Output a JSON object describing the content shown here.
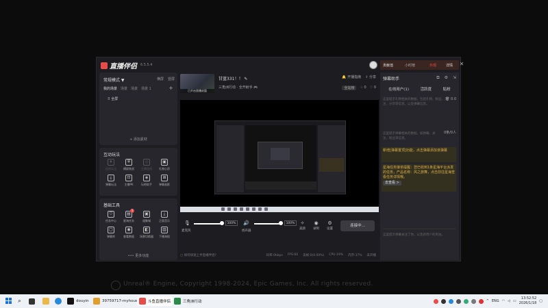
{
  "app": {
    "logo_text": "直播伴侣",
    "version": "6.5.5.4",
    "accent": "#e94a4a"
  },
  "left": {
    "mode_label": "常规模式 ▼",
    "mode_links": [
      "横屏",
      "竖屏"
    ],
    "scene_tabs": [
      "我的场景",
      "场景",
      "场景",
      "场景 1"
    ],
    "scene_item": "全屏",
    "add_source": "+ 添加素材",
    "interact_title": "互动玩法",
    "interact_tools": [
      {
        "label": "连线玩法",
        "icon": "♦",
        "dim": true
      },
      {
        "label": "横屏挑战",
        "icon": "⛨",
        "dim": false
      },
      {
        "label": "主播连线",
        "icon": "◎",
        "dim": true
      },
      {
        "label": "礼物心愿",
        "icon": "▣",
        "dim": false
      },
      {
        "label": "弹幕玩法",
        "icon": "⤓",
        "dim": false
      },
      {
        "label": "主播PK",
        "icon": "⊡",
        "dim": false
      },
      {
        "label": "玩吧助手",
        "icon": "◈",
        "dim": false
      },
      {
        "label": "弹幕画影",
        "icon": "⊞",
        "dim": false
      }
    ],
    "basic_title": "基础工具",
    "basic_tools": [
      {
        "label": "任务中心",
        "icon": "⛉",
        "badge": ""
      },
      {
        "label": "星海任务",
        "icon": "▤",
        "badge": "1"
      },
      {
        "label": "道聚城",
        "icon": "▣",
        "badge": ""
      },
      {
        "label": "正版音乐",
        "icon": "⤓",
        "badge": ""
      },
      {
        "label": "弹幕库",
        "icon": "▢",
        "badge": ""
      },
      {
        "label": "查看数据",
        "icon": "◉",
        "badge": ""
      },
      {
        "label": "场景切换器",
        "icon": "◧",
        "badge": ""
      },
      {
        "label": "下播海报",
        "icon": "▥",
        "badge": ""
      }
    ],
    "more": "••• 更多功能"
  },
  "center": {
    "cover_label": "已开启直播封面",
    "stream_title": "甘蓝331！！",
    "stream_sub": "三角洲行动 · 全开射手 🎮",
    "top_links": [
      "开播指南",
      "分享"
    ],
    "stats": [
      "全站榜",
      "0",
      "0"
    ],
    "mic_label": "麦克风",
    "mic_pct": "100%",
    "speaker_label": "扬声器",
    "speaker_pct": "100%",
    "btn_beauty": "美颜",
    "btn_record": "录制",
    "btn_settings": "设置",
    "connect": "连接中...",
    "status_left": "如何快速上手直播伴侣?",
    "status_right": [
      "码率:0kbps",
      "FPS:60",
      "丢帧:0(0.00%)",
      "CPU:19%",
      "内存:37%",
      "未开播"
    ]
  },
  "right": {
    "top_tabs": [
      "贡献值",
      "小时榜",
      "外观",
      "详情"
    ],
    "helper_title": "弹幕助手",
    "tabs": [
      "在线用户(1)",
      "活跃度",
      "贴粉"
    ],
    "txt1": "这里提示礼物相关的数据，包括礼物、粉丝、关注、分享等信息，以及弹幕信息。",
    "count1": "0.0",
    "txt2": "这里提示弹幕相关的数据，如弹幕、关注、粉丝等信息。",
    "count2": "0条/0人",
    "notice1": "新增[弹幕置顶]功能，点击弹幕添加该弹幕",
    "notice2": "星海任务接单提醒：您已收到1条星海平台派发的任务，产品名称：风之旅舞，点击前往星海查看任务详情哦。",
    "notice2_btn": "去查看 >",
    "txt3": "这里提示弹幕关注了你，以及新用户的到访。"
  },
  "watermark": "Unreal® Engine, Copyright 1998-2024, Epic Games, Inc. All rights reserved.",
  "taskbar": {
    "items": [
      {
        "label": "douyin",
        "color": "#111"
      },
      {
        "label": "39759717-myhouse",
        "color": "#e0a030"
      },
      {
        "label": "斗鱼直播伴侣",
        "color": "#e94a4a"
      },
      {
        "label": "三角洲行动",
        "color": "#2a8a4a"
      }
    ],
    "lang": "ENG",
    "time": "13:52:52",
    "date": "2026/1/18"
  }
}
